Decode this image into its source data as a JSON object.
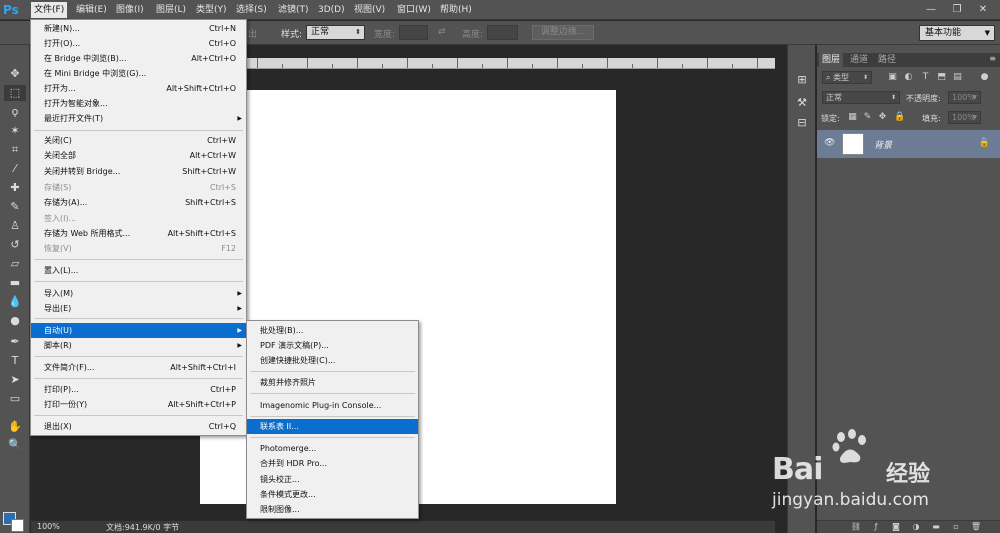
{
  "app": {
    "logo": "Ps"
  },
  "menubar": {
    "items": [
      {
        "label": "文件(F)",
        "active": true
      },
      {
        "label": "编辑(E)"
      },
      {
        "label": "图像(I)"
      },
      {
        "label": "图层(L)"
      },
      {
        "label": "类型(Y)"
      },
      {
        "label": "选择(S)"
      },
      {
        "label": "滤镜(T)"
      },
      {
        "label": "3D(D)"
      },
      {
        "label": "视图(V)"
      },
      {
        "label": "窗口(W)"
      },
      {
        "label": "帮助(H)"
      }
    ],
    "window_buttons": [
      "—",
      "❐",
      "✕"
    ]
  },
  "options_bar": {
    "feather_suffix": "出",
    "style_label": "样式:",
    "style_value": "正常",
    "width_label": "宽度:",
    "height_label": "高度:",
    "refine_edge_label": "调整边缘...",
    "workspace_value": "基本功能"
  },
  "file_menu": {
    "items": [
      {
        "label": "新建(N)...",
        "shortcut": "Ctrl+N"
      },
      {
        "label": "打开(O)...",
        "shortcut": "Ctrl+O"
      },
      {
        "label": "在 Bridge 中浏览(B)...",
        "shortcut": "Alt+Ctrl+O"
      },
      {
        "label": "在 Mini Bridge 中浏览(G)...",
        "shortcut": ""
      },
      {
        "label": "打开为...",
        "shortcut": "Alt+Shift+Ctrl+O"
      },
      {
        "label": "打开为智能对象...",
        "shortcut": ""
      },
      {
        "label": "最近打开文件(T)",
        "shortcut": "",
        "submenu": true
      },
      {
        "label": "关闭(C)",
        "shortcut": "Ctrl+W"
      },
      {
        "label": "关闭全部",
        "shortcut": "Alt+Ctrl+W"
      },
      {
        "label": "关闭并转到 Bridge...",
        "shortcut": "Shift+Ctrl+W"
      },
      {
        "label": "存储(S)",
        "shortcut": "Ctrl+S",
        "disabled": true
      },
      {
        "label": "存储为(A)...",
        "shortcut": "Shift+Ctrl+S"
      },
      {
        "label": "签入(I)...",
        "shortcut": "",
        "disabled": true
      },
      {
        "label": "存储为 Web 所用格式...",
        "shortcut": "Alt+Shift+Ctrl+S"
      },
      {
        "label": "恢复(V)",
        "shortcut": "F12",
        "disabled": true
      },
      {
        "label": "置入(L)...",
        "shortcut": ""
      },
      {
        "label": "导入(M)",
        "shortcut": "",
        "submenu": true
      },
      {
        "label": "导出(E)",
        "shortcut": "",
        "submenu": true
      },
      {
        "label": "自动(U)",
        "shortcut": "",
        "submenu": true,
        "highlighted": true
      },
      {
        "label": "脚本(R)",
        "shortcut": "",
        "submenu": true
      },
      {
        "label": "文件简介(F)...",
        "shortcut": "Alt+Shift+Ctrl+I"
      },
      {
        "label": "打印(P)...",
        "shortcut": "Ctrl+P"
      },
      {
        "label": "打印一份(Y)",
        "shortcut": "Alt+Shift+Ctrl+P"
      },
      {
        "label": "退出(X)",
        "shortcut": "Ctrl+Q"
      }
    ]
  },
  "automate_menu": {
    "items": [
      {
        "label": "批处理(B)..."
      },
      {
        "label": "PDF 演示文稿(P)..."
      },
      {
        "label": "创建快捷批处理(C)..."
      },
      {
        "label": "裁剪并修齐照片"
      },
      {
        "label": "Imagenomic Plug-in Console..."
      },
      {
        "label": "联系表 II...",
        "highlighted": true
      },
      {
        "label": "Photomerge..."
      },
      {
        "label": "合并到 HDR Pro..."
      },
      {
        "label": "镜头校正..."
      },
      {
        "label": "条件模式更改..."
      },
      {
        "label": "限制图像..."
      }
    ]
  },
  "status_bar": {
    "zoom": "100%",
    "doc_info": "文档:941.9K/0 字节"
  },
  "layers_panel": {
    "tabs": [
      "图层",
      "通道",
      "路径"
    ],
    "active_tab": 0,
    "filter_value": "类型",
    "blend_mode": "正常",
    "opacity_label": "不透明度:",
    "opacity_value": "100%",
    "lock_label": "锁定:",
    "fill_label": "填充:",
    "fill_value": "100%",
    "layer_name": "背景"
  },
  "watermark": {
    "brand": "Bai",
    "brand_cn": "经验",
    "url": "jingyan.baidu.com"
  },
  "colors": {
    "accent_highlight": "#0a6ecf",
    "foreground_swatch": "#2d6eb0",
    "ps_logo": "#2fa3f5",
    "selected_layer": "#6c7c94"
  }
}
